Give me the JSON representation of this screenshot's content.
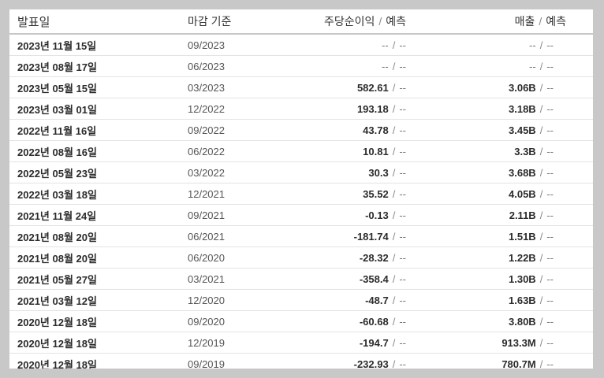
{
  "header": {
    "date": "발표일",
    "period": "마감 기준",
    "eps": "주당순이익",
    "revenue": "매출",
    "separator": "/",
    "forecast": "예측"
  },
  "rows": [
    {
      "date": "2023년 11월 15일",
      "period": "09/2023",
      "eps": "--",
      "eps_forecast": "--",
      "revenue": "--",
      "revenue_forecast": "--"
    },
    {
      "date": "2023년 08월 17일",
      "period": "06/2023",
      "eps": "--",
      "eps_forecast": "--",
      "revenue": "--",
      "revenue_forecast": "--"
    },
    {
      "date": "2023년 05월 15일",
      "period": "03/2023",
      "eps": "582.61",
      "eps_forecast": "--",
      "revenue": "3.06B",
      "revenue_forecast": "--"
    },
    {
      "date": "2023년 03월 01일",
      "period": "12/2022",
      "eps": "193.18",
      "eps_forecast": "--",
      "revenue": "3.18B",
      "revenue_forecast": "--"
    },
    {
      "date": "2022년 11월 16일",
      "period": "09/2022",
      "eps": "43.78",
      "eps_forecast": "--",
      "revenue": "3.45B",
      "revenue_forecast": "--"
    },
    {
      "date": "2022년 08월 16일",
      "period": "06/2022",
      "eps": "10.81",
      "eps_forecast": "--",
      "revenue": "3.3B",
      "revenue_forecast": "--"
    },
    {
      "date": "2022년 05월 23일",
      "period": "03/2022",
      "eps": "30.3",
      "eps_forecast": "--",
      "revenue": "3.68B",
      "revenue_forecast": "--"
    },
    {
      "date": "2022년 03월 18일",
      "period": "12/2021",
      "eps": "35.52",
      "eps_forecast": "--",
      "revenue": "4.05B",
      "revenue_forecast": "--"
    },
    {
      "date": "2021년 11월 24일",
      "period": "09/2021",
      "eps": "-0.13",
      "eps_forecast": "--",
      "revenue": "2.11B",
      "revenue_forecast": "--"
    },
    {
      "date": "2021년 08월 20일",
      "period": "06/2021",
      "eps": "-181.74",
      "eps_forecast": "--",
      "revenue": "1.51B",
      "revenue_forecast": "--"
    },
    {
      "date": "2021년 08월 20일",
      "period": "06/2020",
      "eps": "-28.32",
      "eps_forecast": "--",
      "revenue": "1.22B",
      "revenue_forecast": "--"
    },
    {
      "date": "2021년 05월 27일",
      "period": "03/2021",
      "eps": "-358.4",
      "eps_forecast": "--",
      "revenue": "1.30B",
      "revenue_forecast": "--"
    },
    {
      "date": "2021년 03월 12일",
      "period": "12/2020",
      "eps": "-48.7",
      "eps_forecast": "--",
      "revenue": "1.63B",
      "revenue_forecast": "--"
    },
    {
      "date": "2020년 12월 18일",
      "period": "09/2020",
      "eps": "-60.68",
      "eps_forecast": "--",
      "revenue": "3.80B",
      "revenue_forecast": "--"
    },
    {
      "date": "2020년 12월 18일",
      "period": "12/2019",
      "eps": "-194.7",
      "eps_forecast": "--",
      "revenue": "913.3M",
      "revenue_forecast": "--"
    },
    {
      "date": "2020년 12월 18일",
      "period": "09/2019",
      "eps": "-232.93",
      "eps_forecast": "--",
      "revenue": "780.7M",
      "revenue_forecast": "--"
    }
  ]
}
